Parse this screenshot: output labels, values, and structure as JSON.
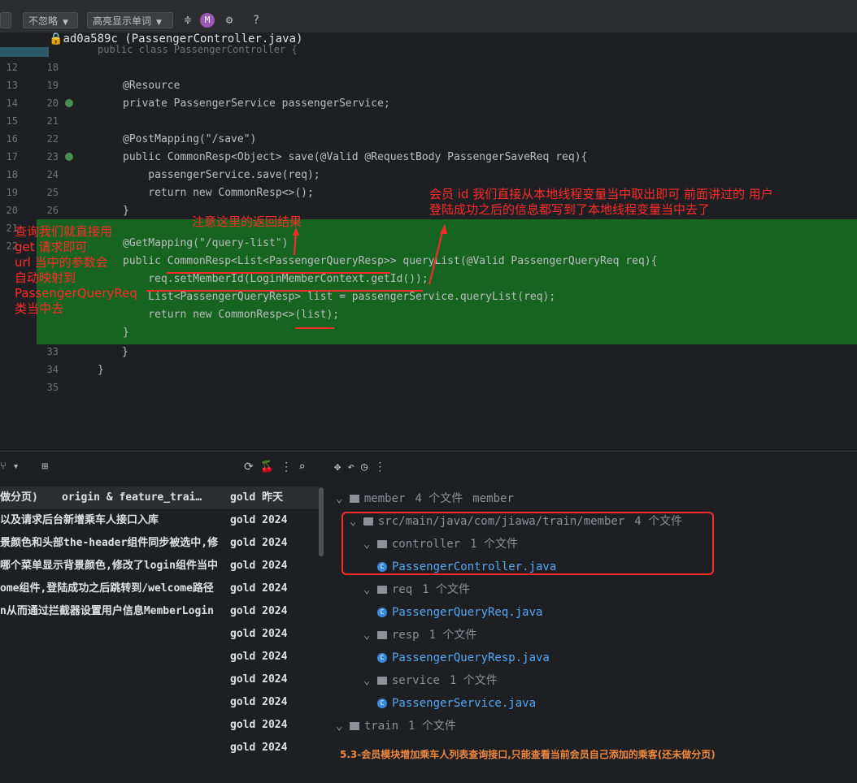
{
  "toolbar": {
    "ignore_dropdown": "不忽略",
    "highlight_dropdown": "高亮显示单词",
    "help": "?"
  },
  "editor": {
    "commit_tip": "ad0a589c (PassengerController.java)",
    "outer_lines": [
      "12",
      "13",
      "14",
      "15",
      "16",
      "17",
      "18",
      "19",
      "20",
      "21",
      "22"
    ],
    "lines": [
      {
        "n": "18",
        "code": ""
      },
      {
        "n": "19",
        "code": "@Resource"
      },
      {
        "n": "20",
        "code": "private PassengerService passengerService;"
      },
      {
        "n": "21",
        "code": ""
      },
      {
        "n": "22",
        "code": "@PostMapping(\"/save\")"
      },
      {
        "n": "23",
        "code": "public CommonResp<Object> save(@Valid @RequestBody PassengerSaveReq req){"
      },
      {
        "n": "24",
        "code": "    passengerService.save(req);"
      },
      {
        "n": "25",
        "code": "    return new CommonResp<>();"
      },
      {
        "n": "26",
        "code": "}"
      }
    ],
    "green_lines": [
      "@GetMapping(\"/query-list\")",
      "public CommonResp<List<PassengerQueryResp>> queryList(@Valid PassengerQueryReq req){",
      "    req.setMemberId(LoginMemberContext.getId());",
      "    List<PassengerQueryResp> list = passengerService.queryList(req);",
      "    return new CommonResp<>(list);",
      "}"
    ],
    "tail_lines": [
      {
        "n": "33",
        "code": "}"
      },
      {
        "n": "34",
        "code": "}"
      },
      {
        "n": "35",
        "code": ""
      }
    ],
    "truncated_top": "public class PassengerController {"
  },
  "annotations": {
    "note_return": "注意这里的返回结果",
    "note_left": [
      "查询我们就直接用",
      "get 请求即可",
      "url 当中的参数会",
      "自动映射到",
      "PassengerQueryReq",
      "类当中去"
    ],
    "note_right": [
      "会员 id 我们直接从本地线程变量当中取出即可 前面讲过的 用户",
      "登陆成功之后的信息都写到了本地线程变量当中去了"
    ]
  },
  "log": {
    "rows": [
      {
        "msg": "做分页)",
        "tags": "origin & feature_trai…",
        "author": "gold 昨天"
      },
      {
        "msg": "以及请求后台新增乘车人接口入库",
        "tags": "",
        "author": "gold 2024"
      },
      {
        "msg": "景颜色和头部the-header组件同步被选中,修",
        "tags": "",
        "author": "gold 2024"
      },
      {
        "msg": "哪个菜单显示背景颜色,修改了login组件当中",
        "tags": "",
        "author": "gold 2024"
      },
      {
        "msg": "ome组件,登陆成功之后跳转到/welcome路径",
        "tags": "",
        "author": "gold 2024"
      },
      {
        "msg": "n从而通过拦截器设置用户信息MemberLogin",
        "tags": "",
        "author": "gold 2024"
      },
      {
        "msg": "",
        "tags": "",
        "author": "gold 2024"
      },
      {
        "msg": "",
        "tags": "",
        "author": "gold 2024"
      },
      {
        "msg": "",
        "tags": "",
        "author": "gold 2024"
      },
      {
        "msg": "",
        "tags": "",
        "author": "gold 2024"
      },
      {
        "msg": "",
        "tags": "",
        "author": "gold 2024"
      },
      {
        "msg": "",
        "tags": "",
        "author": "gold 2024"
      }
    ]
  },
  "tree": {
    "rows": [
      {
        "indent": 0,
        "kind": "folder",
        "name": "member",
        "count": "4 个文件",
        "extra": "member"
      },
      {
        "indent": 1,
        "kind": "folder",
        "name": "src/main/java/com/jiawa/train/member",
        "count": "4 个文件",
        "extra": ""
      },
      {
        "indent": 2,
        "kind": "folder",
        "name": "controller",
        "count": "1 个文件",
        "extra": ""
      },
      {
        "indent": 3,
        "kind": "file",
        "name": "PassengerController.java",
        "count": "",
        "extra": ""
      },
      {
        "indent": 2,
        "kind": "folder",
        "name": "req",
        "count": "1 个文件",
        "extra": ""
      },
      {
        "indent": 3,
        "kind": "file",
        "name": "PassengerQueryReq.java",
        "count": "",
        "extra": ""
      },
      {
        "indent": 2,
        "kind": "folder",
        "name": "resp",
        "count": "1 个文件",
        "extra": ""
      },
      {
        "indent": 3,
        "kind": "file",
        "name": "PassengerQueryResp.java",
        "count": "",
        "extra": ""
      },
      {
        "indent": 2,
        "kind": "folder",
        "name": "service",
        "count": "1 个文件",
        "extra": ""
      },
      {
        "indent": 3,
        "kind": "file",
        "name": "PassengerService.java",
        "count": "",
        "extra": ""
      },
      {
        "indent": 0,
        "kind": "folder",
        "name": "train",
        "count": "1 个文件",
        "extra": ""
      }
    ],
    "commit_message": "5.3-会员模块增加乘车人列表查询接口,只能查看当前会员自己添加的乘客(还未做分页)"
  }
}
